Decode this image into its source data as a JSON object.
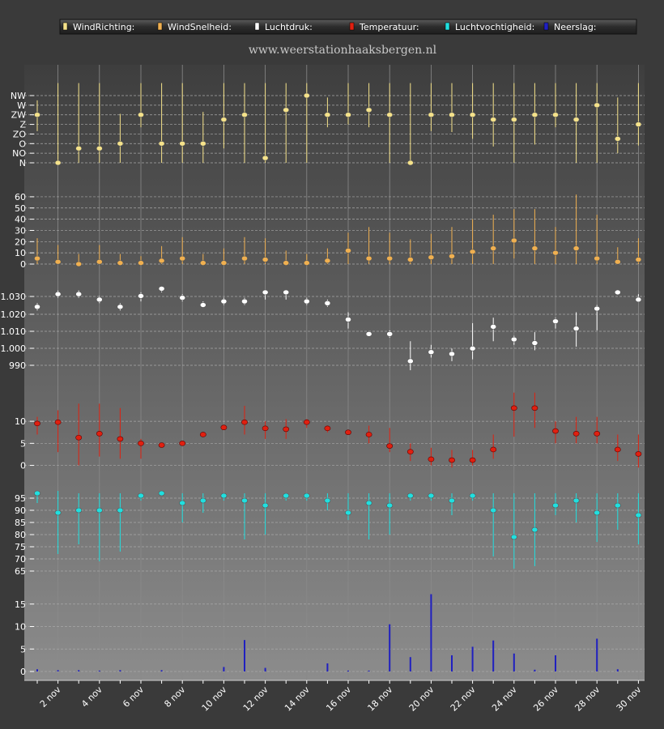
{
  "site_title": "www.weerstationhaaksbergen.nl",
  "legend": [
    {
      "label": "WindRichting:",
      "color": "#f5e28a"
    },
    {
      "label": "WindSnelheid:",
      "color": "#f0b050"
    },
    {
      "label": "Luchtdruk:",
      "color": "#ffffff"
    },
    {
      "label": "Temperatuur:",
      "color": "#e02010"
    },
    {
      "label": "Luchtvochtigheid:",
      "color": "#20e0e0"
    },
    {
      "label": "Neerslag:",
      "color": "#2020c0"
    }
  ],
  "chart_data": {
    "type": "scatter",
    "x_labels": [
      "2 nov",
      "4 nov",
      "6 nov",
      "8 nov",
      "10 nov",
      "12 nov",
      "14 nov",
      "16 nov",
      "18 nov",
      "20 nov",
      "22 nov",
      "24 nov",
      "26 nov",
      "28 nov",
      "30 nov"
    ],
    "days": [
      1,
      2,
      3,
      4,
      5,
      6,
      7,
      8,
      9,
      10,
      11,
      12,
      13,
      14,
      15,
      16,
      17,
      18,
      19,
      20,
      21,
      22,
      23,
      24,
      25,
      26,
      27,
      28,
      29,
      30
    ],
    "grid": true,
    "legend_position": "top",
    "panels": [
      {
        "name": "WindRichting",
        "type": "range-dot",
        "color": "#f5e28a",
        "ticks": [
          "N",
          "NO",
          "O",
          "ZO",
          "Z",
          "ZW",
          "W",
          "NW"
        ],
        "ylim": [
          0,
          7
        ],
        "values": [
          5,
          0,
          1.5,
          1.5,
          2,
          5,
          2,
          2,
          2,
          4.5,
          5,
          0.5,
          5.5,
          7,
          5,
          5,
          5.5,
          5,
          0,
          5,
          5,
          5,
          4.5,
          4.5,
          5,
          5,
          4.5,
          6,
          2.5,
          4
        ],
        "low": [
          3.3,
          0,
          0,
          0,
          0,
          3.7,
          0,
          0,
          0,
          1.5,
          0,
          0,
          0,
          0,
          3.7,
          4,
          3.7,
          0,
          0,
          3.3,
          3.2,
          2.5,
          1.7,
          0,
          1.9,
          3.7,
          0,
          0,
          1,
          1.8
        ],
        "high": [
          6.5,
          8.3,
          8.3,
          8.3,
          5.1,
          8.3,
          8.3,
          8.3,
          5.3,
          8.3,
          8.3,
          8.3,
          8.3,
          8.3,
          6.8,
          8.3,
          8.3,
          8.3,
          8.3,
          8.3,
          8.3,
          8.3,
          8.3,
          8.3,
          8.3,
          8.3,
          8.3,
          8.3,
          6.8,
          8.3
        ]
      },
      {
        "name": "WindSnelheid",
        "type": "range-dot",
        "color": "#f0b050",
        "ticks": [
          0,
          10,
          20,
          30,
          40,
          50,
          60
        ],
        "ylim": [
          0,
          65
        ],
        "values": [
          5,
          2,
          0,
          2,
          1,
          1,
          3,
          5,
          1,
          1,
          5,
          4,
          1,
          1,
          3,
          12,
          5,
          5,
          4,
          6,
          7,
          11,
          14,
          21,
          14,
          10,
          14,
          5,
          2,
          4
        ],
        "low": [
          0,
          0,
          0,
          0,
          0,
          0,
          0,
          0,
          0,
          0,
          0,
          0,
          0,
          0,
          0,
          0,
          0,
          0,
          0,
          0,
          0,
          0,
          0,
          5,
          0,
          0,
          0,
          0,
          0,
          0
        ],
        "high": [
          23,
          17,
          9,
          17,
          9,
          7,
          16,
          24,
          9,
          14,
          24,
          23,
          12,
          9,
          14,
          28,
          33,
          28,
          22,
          27,
          33,
          40,
          44,
          49,
          49,
          33,
          62,
          44,
          15,
          23
        ]
      },
      {
        "name": "Luchtdruk",
        "type": "range-dot",
        "color": "#ffffff",
        "ticks": [
          990,
          1000,
          1010,
          1020,
          1030
        ],
        "tick_labels": [
          "990",
          "1.000",
          "1.010",
          "1.020",
          "1.030"
        ],
        "ylim": [
          985,
          1040
        ],
        "values": [
          1024,
          1031,
          1031,
          1028,
          1024,
          1030,
          1034,
          1029,
          1025,
          1027,
          1027,
          1032,
          1032,
          1027,
          1026,
          1017,
          1009,
          1009,
          994,
          999,
          998,
          1001,
          1013,
          1006,
          1004,
          1016,
          1012,
          1023,
          1032,
          1028
        ],
        "low": [
          1022,
          1029,
          1029,
          1026,
          1022,
          1027,
          1032,
          1027,
          1024,
          1025,
          1025,
          1028,
          1028,
          1025,
          1024,
          1012,
          1008,
          1007,
          989,
          996,
          994,
          995,
          1005,
          1003,
          1000,
          1012,
          1002,
          1011,
          1031,
          1027
        ],
        "high": [
          1026,
          1033,
          1033,
          1030,
          1026,
          1032,
          1035,
          1031,
          1027,
          1029,
          1029,
          1033,
          1033,
          1029,
          1028,
          1021,
          1010,
          1011,
          1005,
          1003,
          1001,
          1015,
          1018,
          1008,
          1010,
          1018,
          1021,
          1025,
          1033,
          1031
        ]
      },
      {
        "name": "Temperatuur",
        "type": "range-dot",
        "color": "#e02010",
        "ticks": [
          0,
          5,
          10
        ],
        "ylim": [
          -1,
          17
        ],
        "values": [
          9.5,
          9.8,
          6.3,
          7.2,
          6,
          5,
          4.6,
          5,
          7,
          8.6,
          9.8,
          8.4,
          8.2,
          9.8,
          8.4,
          7.5,
          7,
          4.4,
          3.1,
          1.4,
          1.2,
          1.2,
          3.6,
          13,
          13,
          7.8,
          7.2,
          7.2,
          3.6,
          2.6
        ],
        "low": [
          7,
          3,
          0,
          2,
          1.5,
          1.5,
          4,
          4.5,
          6.5,
          8,
          7,
          6,
          6,
          8.5,
          7.5,
          7,
          5,
          3,
          1,
          0,
          -0.5,
          0,
          1.5,
          6.5,
          8.5,
          5,
          5,
          5,
          1,
          -0.5
        ],
        "high": [
          11,
          12.5,
          14,
          14,
          13,
          6,
          5,
          5.5,
          7.5,
          9.2,
          13.5,
          10,
          10.5,
          10.5,
          9,
          8,
          9,
          8.5,
          5,
          4,
          3.5,
          3.5,
          7,
          16.5,
          16.5,
          10,
          11,
          11,
          7,
          7
        ]
      },
      {
        "name": "Luchtvochtigheid",
        "type": "range-dot",
        "color": "#20e0e0",
        "ticks": [
          65,
          70,
          75,
          80,
          85,
          90,
          95
        ],
        "ylim": [
          61,
          100
        ],
        "values": [
          97,
          89,
          90,
          90,
          90,
          96,
          97,
          93,
          94,
          96,
          94,
          92,
          96,
          96,
          94,
          89,
          93,
          92,
          96,
          96,
          94,
          96,
          90,
          79,
          82,
          92,
          94,
          89,
          92,
          88
        ],
        "low": [
          93,
          72,
          76,
          69,
          73,
          94,
          96,
          85,
          89,
          94,
          78,
          80,
          94,
          94,
          90,
          86,
          78,
          80,
          94,
          94,
          88,
          94,
          71,
          66,
          67,
          88,
          85,
          77,
          82,
          76
        ],
        "high": [
          98,
          98,
          97,
          97,
          97,
          97,
          98,
          97,
          97,
          97,
          97,
          97,
          97,
          97,
          97,
          97,
          97,
          97,
          97,
          97,
          97,
          97,
          97,
          97,
          97,
          97,
          97,
          97,
          97,
          97
        ]
      },
      {
        "name": "Neerslag",
        "type": "bar",
        "color": "#2020c0",
        "ticks": [
          0,
          5,
          10,
          15
        ],
        "ylim": [
          0,
          20
        ],
        "values": [
          0.5,
          0.3,
          0.3,
          0.2,
          0.3,
          0,
          0.3,
          0,
          0,
          1,
          7,
          0.8,
          0,
          0,
          1.8,
          0.2,
          0.2,
          10.5,
          3.2,
          17.2,
          3.6,
          5.5,
          6.9,
          4,
          0.4,
          3.6,
          0,
          7.3,
          0.5,
          0
        ]
      }
    ]
  }
}
